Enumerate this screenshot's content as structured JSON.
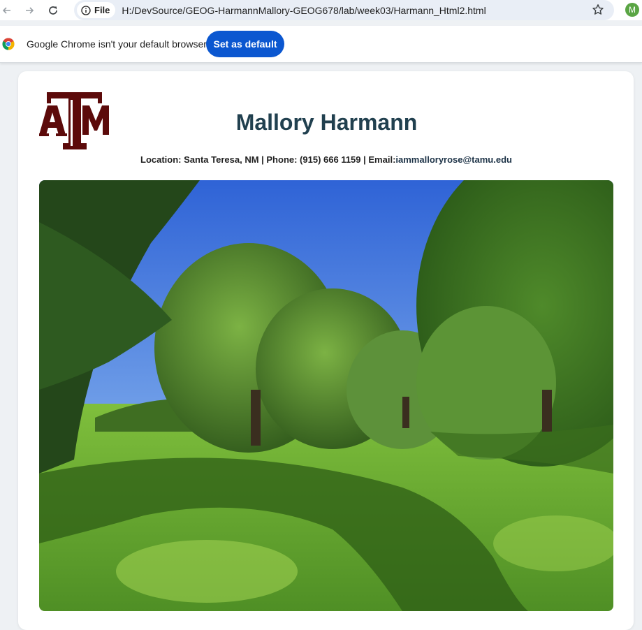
{
  "browser": {
    "nav": {
      "back_icon": "back-arrow-icon",
      "forward_icon": "forward-arrow-icon",
      "reload_icon": "reload-icon"
    },
    "site_info_chip_label": "File",
    "url": "H:/DevSource/GEOG-HarmannMallory-GEOG678/lab/week03/Harmann_Html2.html",
    "bookmark_icon": "star-icon",
    "profile_initial": "M",
    "profile_color": "#5aa544"
  },
  "infobar": {
    "message": "Google Chrome isn't your default browser",
    "button_label": "Set as default",
    "button_color": "#0b57d0"
  },
  "page": {
    "logo_text": "ATM",
    "logo_color": "#5c0a0a",
    "name": "Mallory Harmann",
    "name_color": "#21404f",
    "contact_prefix": "Location: Santa Teresa, NM | Phone: (915) 666 1159 | Email:",
    "contact_email": "iammalloryrose@tamu.edu",
    "photo_subject": "pecan orchard with green grass and tree shadows"
  }
}
